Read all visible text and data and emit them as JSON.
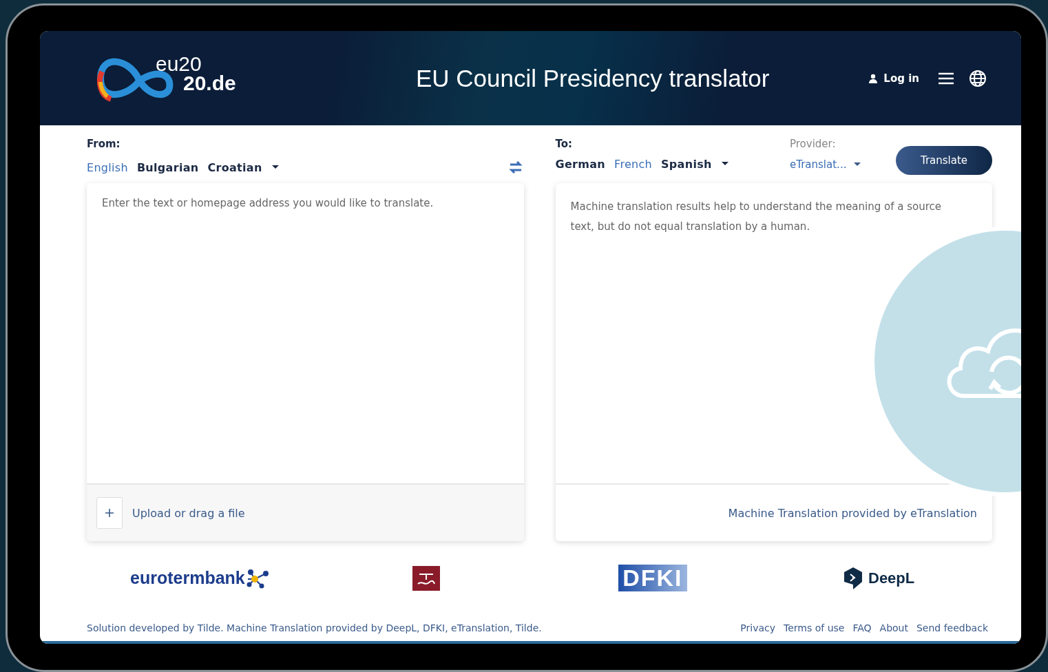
{
  "header": {
    "logo_lines": [
      "eu20",
      "20.de"
    ],
    "title": "EU Council Presidency translator",
    "login": "Log in"
  },
  "source": {
    "label": "From:",
    "languages": [
      {
        "name": "English",
        "selected": true
      },
      {
        "name": "Bulgarian",
        "selected": false
      },
      {
        "name": "Croatian",
        "selected": false
      }
    ],
    "placeholder": "Enter the text or homepage address you would like to translate.",
    "upload": "Upload or drag a file"
  },
  "target": {
    "label": "To:",
    "languages": [
      {
        "name": "German",
        "selected": false
      },
      {
        "name": "French",
        "selected": true
      },
      {
        "name": "Spanish",
        "selected": false
      }
    ],
    "provider_label": "Provider:",
    "provider": "eTranslat...",
    "translate_button": "Translate",
    "notice": "Machine translation results help to understand the meaning of a source text, but do not equal translation by a human.",
    "credit": "Machine Translation provided by eTranslation"
  },
  "partners": [
    "eurotermbank",
    "DFKI",
    "DeepL"
  ],
  "footer": {
    "text": "Solution developed by Tilde. Machine Translation provided by DeepL, DFKI, eTranslation, Tilde.",
    "links": [
      "Privacy",
      "Terms of use",
      "FAQ",
      "About",
      "Send feedback"
    ]
  }
}
